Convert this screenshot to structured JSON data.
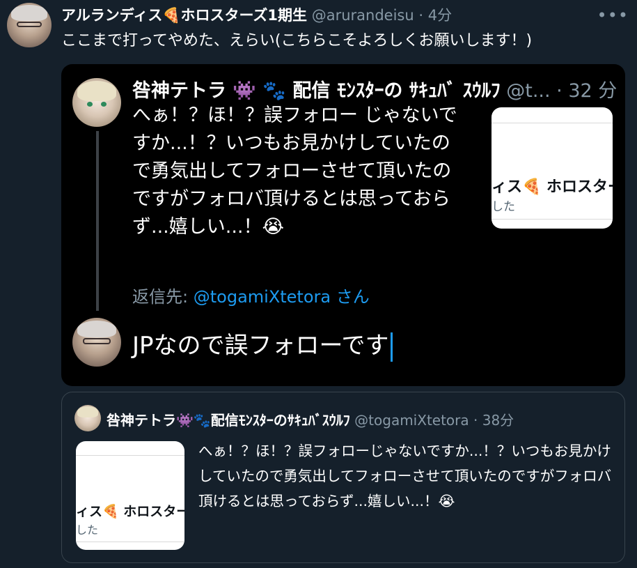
{
  "tweet": {
    "display_name": "アルランディス🍕ホロスターズ1期生",
    "handle": "@arurandeisu",
    "time": "· 4分",
    "text": "ここまで打ってやめた、えらい(こちらこそよろしくお願いします！)",
    "more_icon": "•••"
  },
  "screenshot": {
    "display_name": "咎神テトラ 👾 🐾 配信 ﾓﾝｽﾀｰの ｻｷｭﾊﾞ ｽｳﾙﾌ",
    "handle": "@t...",
    "time": "· 32 分",
    "text": "へぁ！？ほ！？誤フォロー じゃないですか...！？いつもお見かけしていたので勇気出してフォローさせて頂いたのですがフォロバ頂けるとは思っておらず...嬉しい...！😭",
    "card_text": "ィス🍕 ホロスターズ",
    "card_sub": "した",
    "reply_label": "返信先:",
    "reply_handle": "@togamiXtetora",
    "reply_suffix": " さん",
    "compose_text": "JPなので誤フォローです"
  },
  "quote": {
    "display_name": "咎神テトラ👾🐾配信ﾓﾝｽﾀｰのｻｷｭﾊﾞｽｳﾙﾌ",
    "handle": "@togamiXtetora",
    "time": "· 38分",
    "text": "へぁ！？ほ！？誤フォローじゃないですか...！？いつもお見かけしていたので勇気出してフォローさせて頂いたのですがフォロバ頂けるとは思っておらず...嬉しい...！😭",
    "card_text": "ィス🍕 ホロスターズ",
    "card_sub": "した"
  },
  "colors": {
    "background": "#15202b",
    "muted": "#8899a6",
    "link": "#1d9bf0",
    "border": "#38444d"
  }
}
